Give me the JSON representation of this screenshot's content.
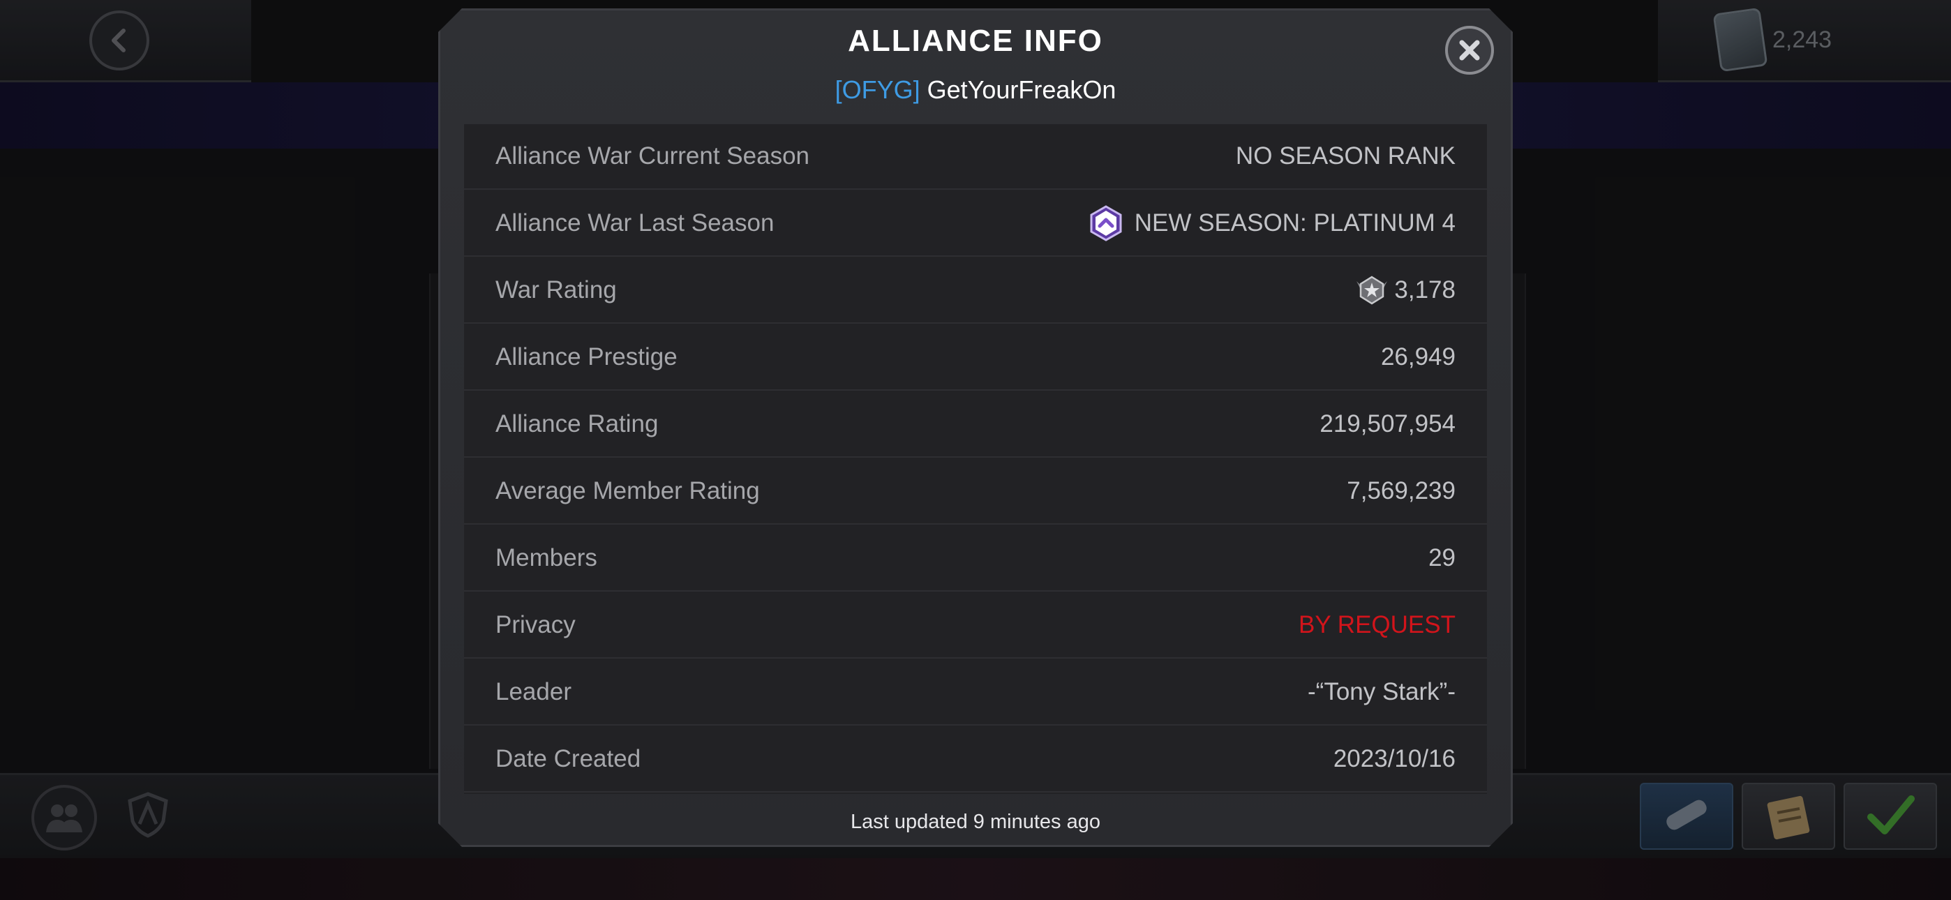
{
  "background": {
    "currency_value": "2,243"
  },
  "modal": {
    "title": "ALLIANCE INFO",
    "alliance_tag": "[OFYG]",
    "alliance_name": "GetYourFreakOn",
    "rows": [
      {
        "label": "Alliance War Current Season",
        "value": "NO SEASON RANK"
      },
      {
        "label": "Alliance War Last Season",
        "value": "NEW SEASON: PLATINUM 4"
      },
      {
        "label": "War Rating",
        "value": "3,178"
      },
      {
        "label": "Alliance Prestige",
        "value": "26,949"
      },
      {
        "label": "Alliance Rating",
        "value": "219,507,954"
      },
      {
        "label": "Average Member Rating",
        "value": "7,569,239"
      },
      {
        "label": "Members",
        "value": "29"
      },
      {
        "label": "Privacy",
        "value": "BY REQUEST"
      },
      {
        "label": "Leader",
        "value": "-“Tony Stark”-"
      },
      {
        "label": "Date Created",
        "value": "2023/10/16"
      }
    ],
    "footer": "Last updated 9 minutes ago"
  },
  "colors": {
    "tag_blue": "#3e9be4",
    "privacy_red": "#d2141b",
    "badge_purple": "#7a4fc9"
  }
}
